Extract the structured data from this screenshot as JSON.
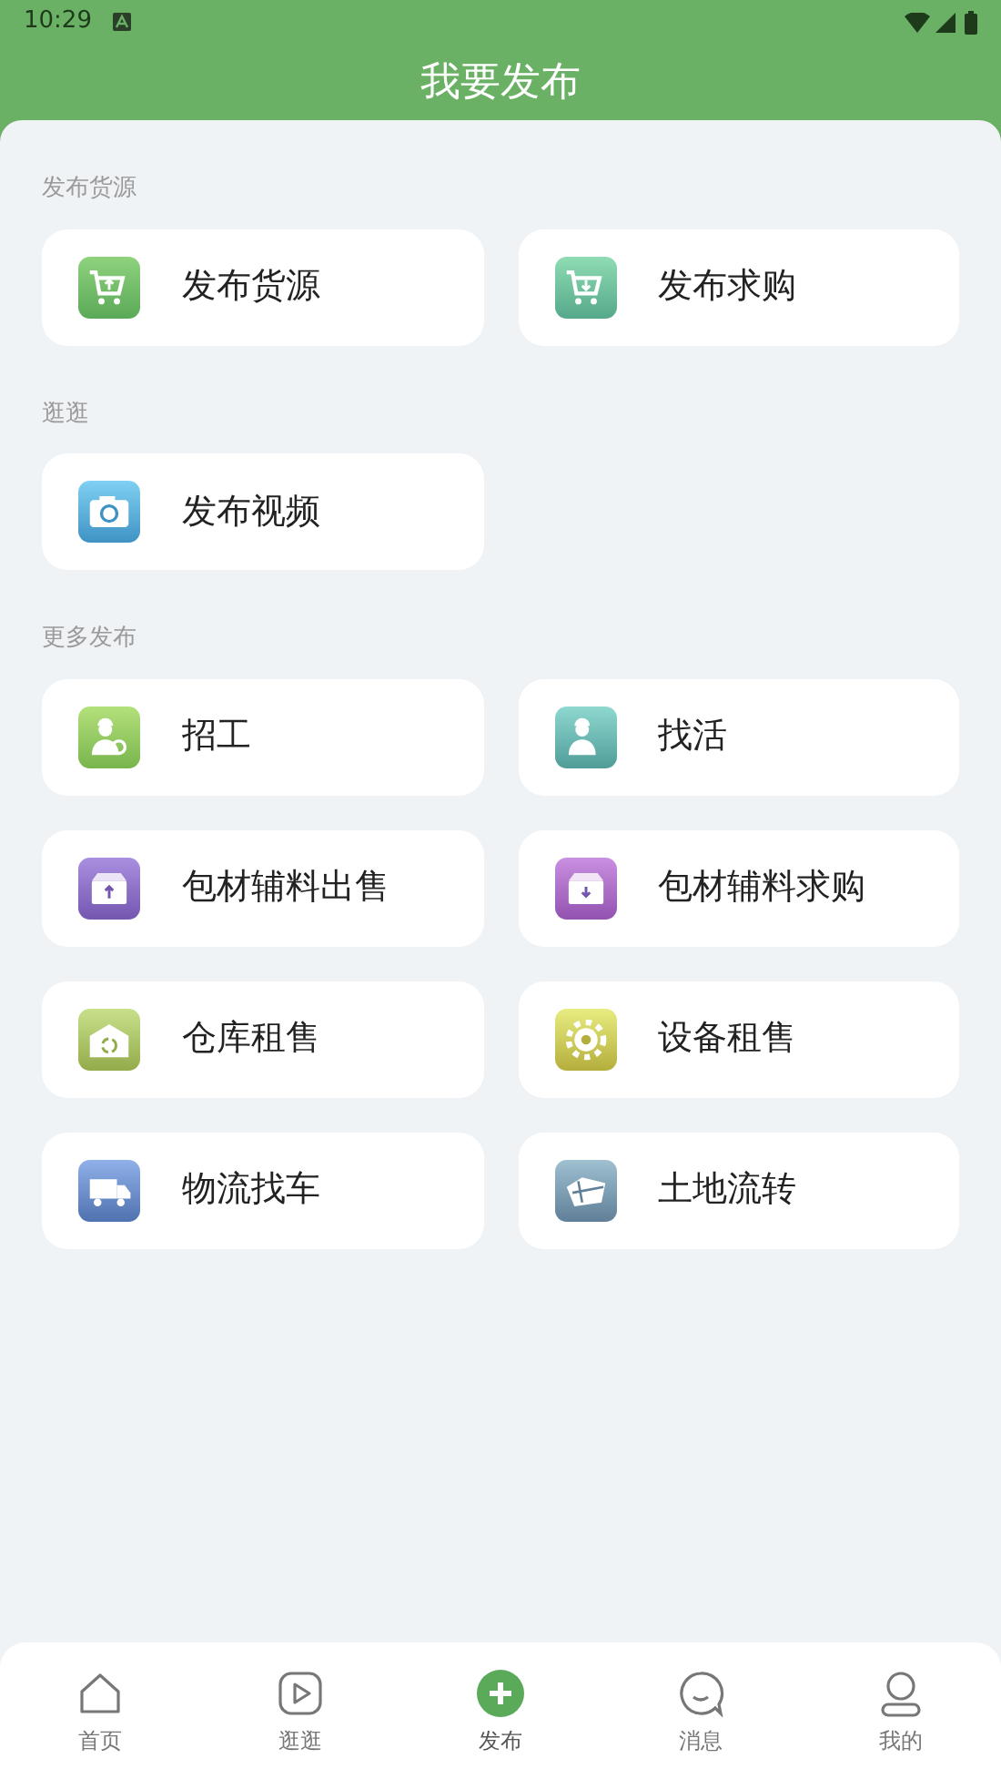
{
  "status_bar": {
    "time": "10:29"
  },
  "header": {
    "title": "我要发布"
  },
  "sections": [
    {
      "title": "发布货源",
      "items": [
        {
          "label": "发布货源",
          "kind": "cart-up"
        },
        {
          "label": "发布求购",
          "kind": "cart-down"
        }
      ]
    },
    {
      "title": "逛逛",
      "items": [
        {
          "label": "发布视频",
          "kind": "camera"
        }
      ]
    },
    {
      "title": "更多发布",
      "items": [
        {
          "label": "招工",
          "kind": "worker-search"
        },
        {
          "label": "找活",
          "kind": "worker"
        },
        {
          "label": "包材辅料出售",
          "kind": "box-up"
        },
        {
          "label": "包材辅料求购",
          "kind": "box-down"
        },
        {
          "label": "仓库租售",
          "kind": "warehouse"
        },
        {
          "label": "设备租售",
          "kind": "gear"
        },
        {
          "label": "物流找车",
          "kind": "truck"
        },
        {
          "label": "土地流转",
          "kind": "land"
        }
      ]
    }
  ],
  "tab_bar": [
    {
      "label": "首页",
      "kind": "home",
      "selected": false
    },
    {
      "label": "逛逛",
      "kind": "play",
      "selected": false
    },
    {
      "label": "发布",
      "kind": "plus",
      "selected": true
    },
    {
      "label": "消息",
      "kind": "chat",
      "selected": false
    },
    {
      "label": "我的",
      "kind": "user",
      "selected": false
    }
  ]
}
